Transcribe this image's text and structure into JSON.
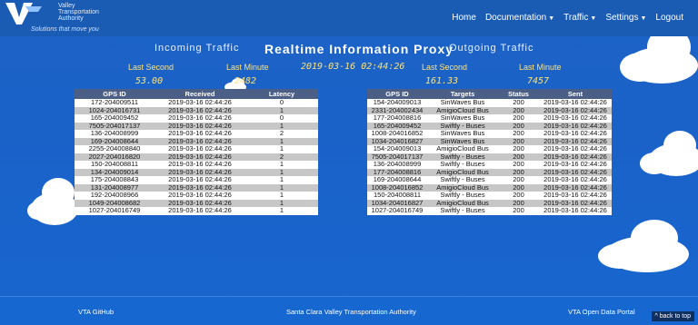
{
  "brand": {
    "line1": "Valley",
    "line2": "Transportation",
    "line3": "Authority",
    "tagline": "Solutions that move you"
  },
  "nav": {
    "home": "Home",
    "documentation": "Documentation",
    "traffic": "Traffic",
    "settings": "Settings",
    "logout": "Logout"
  },
  "header": {
    "incoming": "Incoming Traffic",
    "title": "Realtime Information Proxy",
    "outgoing": "Outgoing Traffic",
    "datetime": "2019-03-16 02:44:26"
  },
  "metrics": {
    "in_last_second_label": "Last Second",
    "in_last_second_value": "53.00",
    "in_last_minute_label": "Last Minute",
    "in_last_minute_value": "2482",
    "out_last_second_label": "Last Second",
    "out_last_second_value": "161.33",
    "out_last_minute_label": "Last Minute",
    "out_last_minute_value": "7457"
  },
  "incoming_table": {
    "headers": [
      "GPS ID",
      "Received",
      "Latency"
    ],
    "rows": [
      [
        "172-204009511",
        "2019-03-16 02:44:26",
        "0"
      ],
      [
        "1024-204016731",
        "2019-03-16 02:44:26",
        "1"
      ],
      [
        "165-204009452",
        "2019-03-16 02:44:26",
        "0"
      ],
      [
        "7505-204017137",
        "2019-03-16 02:44:26",
        "1"
      ],
      [
        "136-204008999",
        "2019-03-16 02:44:26",
        "2"
      ],
      [
        "169-204008644",
        "2019-03-16 02:44:26",
        "1"
      ],
      [
        "2255-204008840",
        "2019-03-16 02:44:26",
        "1"
      ],
      [
        "2027-204016820",
        "2019-03-16 02:44:26",
        "2"
      ],
      [
        "150-204008811",
        "2019-03-16 02:44:26",
        "1"
      ],
      [
        "134-204009014",
        "2019-03-16 02:44:26",
        "1"
      ],
      [
        "175-204008843",
        "2019-03-16 02:44:26",
        "1"
      ],
      [
        "131-204008977",
        "2019-03-16 02:44:26",
        "1"
      ],
      [
        "192-204008966",
        "2019-03-16 02:44:26",
        "1"
      ],
      [
        "1049-204008682",
        "2019-03-16 02:44:26",
        "1"
      ],
      [
        "1027-204016749",
        "2019-03-16 02:44:26",
        "1"
      ]
    ]
  },
  "outgoing_table": {
    "headers": [
      "GPS ID",
      "Targets",
      "Status",
      "Sent"
    ],
    "rows": [
      [
        "154-204009013",
        "SinWaves Bus",
        "200",
        "2019-03-16 02:44:26"
      ],
      [
        "2331-204002434",
        "AmigioCloud Bus",
        "200",
        "2019-03-16 02:44:26"
      ],
      [
        "177-204008816",
        "SinWaves Bus",
        "200",
        "2019-03-16 02:44:26"
      ],
      [
        "165-204009452",
        "Swiftly - Buses",
        "200",
        "2019-03-16 02:44:26"
      ],
      [
        "1008-204016852",
        "SinWaves Bus",
        "200",
        "2019-03-16 02:44:26"
      ],
      [
        "1034-204016827",
        "SinWaves Bus",
        "200",
        "2019-03-16 02:44:26"
      ],
      [
        "154-204009013",
        "AmigioCloud Bus",
        "200",
        "2019-03-16 02:44:26"
      ],
      [
        "7505-204017137",
        "Swiftly - Buses",
        "200",
        "2019-03-16 02:44:26"
      ],
      [
        "136-204008999",
        "Swiftly - Buses",
        "200",
        "2019-03-16 02:44:26"
      ],
      [
        "177-204008816",
        "AmigioCloud Bus",
        "200",
        "2019-03-16 02:44:26"
      ],
      [
        "169-204008644",
        "Swiftly - Buses",
        "200",
        "2019-03-16 02:44:26"
      ],
      [
        "1008-204016852",
        "AmigioCloud Bus",
        "200",
        "2019-03-16 02:44:26"
      ],
      [
        "150-204008811",
        "Swiftly - Buses",
        "200",
        "2019-03-16 02:44:26"
      ],
      [
        "1034-204016827",
        "AmigioCloud Bus",
        "200",
        "2019-03-16 02:44:26"
      ],
      [
        "1027-204016749",
        "Swiftly - Buses",
        "200",
        "2019-03-16 02:44:26"
      ]
    ]
  },
  "footer": {
    "github": "VTA GitHub",
    "authority": "Santa Clara Valley Transportation Authority",
    "portal": "VTA Open Data Portal",
    "back_to_top": "^ back to top"
  },
  "colors": {
    "background": "#1a62c8",
    "navbar": "#1a5cb4",
    "table_header": "#4a5e86",
    "metric": "#ffe27a"
  }
}
